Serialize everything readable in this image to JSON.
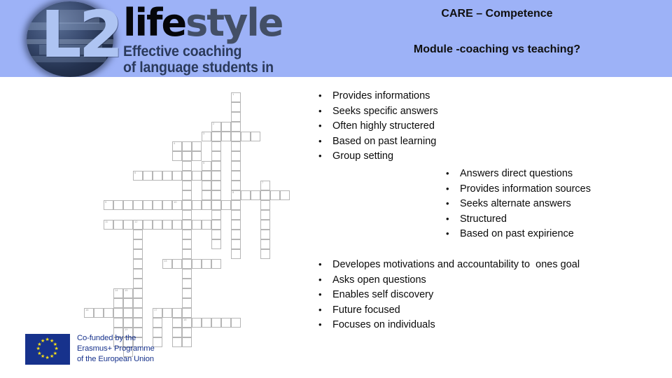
{
  "slide": {
    "background_color": "#ffffff",
    "header_band_color": "#9db2f7"
  },
  "header": {
    "title": "CARE – Competence",
    "subtitle": "Module -coaching vs teaching?",
    "brand": {
      "monogram": "L2",
      "wordmark_part1": "life",
      "wordmark_part2": "style",
      "wordmark_color1": "#05060a",
      "wordmark_color2": "#434f66",
      "tagline_line1": "Effective coaching",
      "tagline_line2": "of language students in Europe",
      "tagline_color": "#2b3a5c"
    }
  },
  "bullet_char": "•",
  "lists": {
    "teaching": {
      "name": "teaching-characteristics",
      "items": [
        "Provides informations",
        "Seeks specific answers",
        "Often highly structered",
        "Based on past learning",
        "Group setting"
      ]
    },
    "mentoring": {
      "name": "mentoring-characteristics",
      "items": [
        "Answers direct questions",
        "Provides information sources",
        "Seeks alternate answers",
        "Structured",
        "Based on past expirience"
      ]
    },
    "coaching": {
      "name": "coaching-characteristics",
      "items": [
        "Developes motivations and accountability to  ones goal",
        "Asks open questions",
        "Enables self discovery",
        "Future focused",
        "Focuses on individuals"
      ]
    }
  },
  "eu_logo": {
    "flag_color": "#17328c",
    "star_color": "#f7e017",
    "line1": "Co-funded by the",
    "line2": "Erasmus+ Programme",
    "line3": "of the European Union"
  },
  "crossword": {
    "note": "decorative faint crossword grid background",
    "cell_size": 14,
    "border_color": "#b6b6b6",
    "cells": [
      {
        "c": 13,
        "r": 0,
        "n": "1"
      },
      {
        "c": 13,
        "r": 1,
        "n": ""
      },
      {
        "c": 13,
        "r": 2,
        "n": ""
      },
      {
        "c": 13,
        "r": 3,
        "n": ""
      },
      {
        "c": 11,
        "r": 3,
        "n": "2"
      },
      {
        "c": 12,
        "r": 3,
        "n": ""
      },
      {
        "c": 10,
        "r": 4,
        "n": "3"
      },
      {
        "c": 11,
        "r": 4,
        "n": ""
      },
      {
        "c": 12,
        "r": 4,
        "n": ""
      },
      {
        "c": 13,
        "r": 4,
        "n": ""
      },
      {
        "c": 14,
        "r": 4,
        "n": ""
      },
      {
        "c": 15,
        "r": 4,
        "n": ""
      },
      {
        "c": 11,
        "r": 5,
        "n": ""
      },
      {
        "c": 13,
        "r": 5,
        "n": ""
      },
      {
        "c": 7,
        "r": 5,
        "n": "4"
      },
      {
        "c": 8,
        "r": 5,
        "n": ""
      },
      {
        "c": 9,
        "r": 5,
        "n": ""
      },
      {
        "c": 7,
        "r": 6,
        "n": ""
      },
      {
        "c": 8,
        "r": 6,
        "n": ""
      },
      {
        "c": 9,
        "r": 6,
        "n": ""
      },
      {
        "c": 11,
        "r": 6,
        "n": ""
      },
      {
        "c": 13,
        "r": 6,
        "n": ""
      },
      {
        "c": 8,
        "r": 7,
        "n": ""
      },
      {
        "c": 11,
        "r": 7,
        "n": ""
      },
      {
        "c": 13,
        "r": 7,
        "n": ""
      },
      {
        "c": 10,
        "r": 7,
        "n": "5"
      },
      {
        "c": 3,
        "r": 8,
        "n": "6"
      },
      {
        "c": 4,
        "r": 8,
        "n": ""
      },
      {
        "c": 5,
        "r": 8,
        "n": ""
      },
      {
        "c": 6,
        "r": 8,
        "n": ""
      },
      {
        "c": 7,
        "r": 8,
        "n": ""
      },
      {
        "c": 8,
        "r": 8,
        "n": ""
      },
      {
        "c": 9,
        "r": 8,
        "n": ""
      },
      {
        "c": 10,
        "r": 8,
        "n": ""
      },
      {
        "c": 11,
        "r": 8,
        "n": ""
      },
      {
        "c": 13,
        "r": 8,
        "n": ""
      },
      {
        "c": 8,
        "r": 9,
        "n": ""
      },
      {
        "c": 10,
        "r": 9,
        "n": ""
      },
      {
        "c": 11,
        "r": 9,
        "n": ""
      },
      {
        "c": 13,
        "r": 9,
        "n": ""
      },
      {
        "c": 16,
        "r": 9,
        "n": "7"
      },
      {
        "c": 8,
        "r": 10,
        "n": ""
      },
      {
        "c": 10,
        "r": 10,
        "n": ""
      },
      {
        "c": 11,
        "r": 10,
        "n": ""
      },
      {
        "c": 13,
        "r": 10,
        "n": "8"
      },
      {
        "c": 14,
        "r": 10,
        "n": ""
      },
      {
        "c": 15,
        "r": 10,
        "n": ""
      },
      {
        "c": 16,
        "r": 10,
        "n": ""
      },
      {
        "c": 17,
        "r": 10,
        "n": ""
      },
      {
        "c": 18,
        "r": 10,
        "n": ""
      },
      {
        "c": 0,
        "r": 11,
        "n": "9"
      },
      {
        "c": 1,
        "r": 11,
        "n": ""
      },
      {
        "c": 2,
        "r": 11,
        "n": ""
      },
      {
        "c": 3,
        "r": 11,
        "n": ""
      },
      {
        "c": 4,
        "r": 11,
        "n": ""
      },
      {
        "c": 5,
        "r": 11,
        "n": ""
      },
      {
        "c": 6,
        "r": 11,
        "n": ""
      },
      {
        "c": 7,
        "r": 11,
        "n": "10"
      },
      {
        "c": 8,
        "r": 11,
        "n": ""
      },
      {
        "c": 9,
        "r": 11,
        "n": ""
      },
      {
        "c": 10,
        "r": 11,
        "n": ""
      },
      {
        "c": 11,
        "r": 11,
        "n": ""
      },
      {
        "c": 12,
        "r": 11,
        "n": ""
      },
      {
        "c": 13,
        "r": 11,
        "n": ""
      },
      {
        "c": 16,
        "r": 11,
        "n": ""
      },
      {
        "c": 8,
        "r": 12,
        "n": ""
      },
      {
        "c": 11,
        "r": 12,
        "n": ""
      },
      {
        "c": 13,
        "r": 12,
        "n": ""
      },
      {
        "c": 16,
        "r": 12,
        "n": ""
      },
      {
        "c": 0,
        "r": 13,
        "n": "11"
      },
      {
        "c": 1,
        "r": 13,
        "n": ""
      },
      {
        "c": 2,
        "r": 13,
        "n": ""
      },
      {
        "c": 3,
        "r": 13,
        "n": "12"
      },
      {
        "c": 4,
        "r": 13,
        "n": ""
      },
      {
        "c": 5,
        "r": 13,
        "n": ""
      },
      {
        "c": 6,
        "r": 13,
        "n": ""
      },
      {
        "c": 7,
        "r": 13,
        "n": ""
      },
      {
        "c": 8,
        "r": 13,
        "n": ""
      },
      {
        "c": 9,
        "r": 13,
        "n": ""
      },
      {
        "c": 10,
        "r": 13,
        "n": ""
      },
      {
        "c": 11,
        "r": 13,
        "n": ""
      },
      {
        "c": 13,
        "r": 13,
        "n": ""
      },
      {
        "c": 16,
        "r": 13,
        "n": ""
      },
      {
        "c": 3,
        "r": 14,
        "n": ""
      },
      {
        "c": 8,
        "r": 14,
        "n": ""
      },
      {
        "c": 11,
        "r": 14,
        "n": ""
      },
      {
        "c": 13,
        "r": 14,
        "n": ""
      },
      {
        "c": 16,
        "r": 14,
        "n": ""
      },
      {
        "c": 3,
        "r": 15,
        "n": ""
      },
      {
        "c": 8,
        "r": 15,
        "n": ""
      },
      {
        "c": 11,
        "r": 15,
        "n": ""
      },
      {
        "c": 13,
        "r": 15,
        "n": ""
      },
      {
        "c": 16,
        "r": 15,
        "n": ""
      },
      {
        "c": 3,
        "r": 16,
        "n": ""
      },
      {
        "c": 8,
        "r": 16,
        "n": ""
      },
      {
        "c": 13,
        "r": 16,
        "n": ""
      },
      {
        "c": 16,
        "r": 16,
        "n": ""
      },
      {
        "c": 3,
        "r": 17,
        "n": ""
      },
      {
        "c": 6,
        "r": 17,
        "n": "13"
      },
      {
        "c": 7,
        "r": 17,
        "n": ""
      },
      {
        "c": 8,
        "r": 17,
        "n": ""
      },
      {
        "c": 9,
        "r": 17,
        "n": ""
      },
      {
        "c": 10,
        "r": 17,
        "n": ""
      },
      {
        "c": 11,
        "r": 17,
        "n": ""
      },
      {
        "c": 3,
        "r": 18,
        "n": ""
      },
      {
        "c": 8,
        "r": 18,
        "n": ""
      },
      {
        "c": 3,
        "r": 19,
        "n": ""
      },
      {
        "c": 8,
        "r": 19,
        "n": ""
      },
      {
        "c": 1,
        "r": 20,
        "n": "14"
      },
      {
        "c": 3,
        "r": 20,
        "n": ""
      },
      {
        "c": 2,
        "r": 20,
        "n": "15"
      },
      {
        "c": 8,
        "r": 20,
        "n": ""
      },
      {
        "c": 1,
        "r": 21,
        "n": ""
      },
      {
        "c": 2,
        "r": 21,
        "n": ""
      },
      {
        "c": 3,
        "r": 21,
        "n": ""
      },
      {
        "c": 8,
        "r": 21,
        "n": ""
      },
      {
        "c": -2,
        "r": 22,
        "n": "16"
      },
      {
        "c": -1,
        "r": 22,
        "n": ""
      },
      {
        "c": 0,
        "r": 22,
        "n": ""
      },
      {
        "c": 1,
        "r": 22,
        "n": ""
      },
      {
        "c": 2,
        "r": 22,
        "n": ""
      },
      {
        "c": 3,
        "r": 22,
        "n": ""
      },
      {
        "c": 5,
        "r": 22,
        "n": "17"
      },
      {
        "c": 6,
        "r": 22,
        "n": ""
      },
      {
        "c": 7,
        "r": 22,
        "n": ""
      },
      {
        "c": 8,
        "r": 22,
        "n": ""
      },
      {
        "c": 1,
        "r": 23,
        "n": ""
      },
      {
        "c": 2,
        "r": 23,
        "n": ""
      },
      {
        "c": 3,
        "r": 23,
        "n": ""
      },
      {
        "c": 5,
        "r": 23,
        "n": ""
      },
      {
        "c": 7,
        "r": 23,
        "n": ""
      },
      {
        "c": 8,
        "r": 23,
        "n": "18"
      },
      {
        "c": 9,
        "r": 23,
        "n": ""
      },
      {
        "c": 10,
        "r": 23,
        "n": ""
      },
      {
        "c": 11,
        "r": 23,
        "n": ""
      },
      {
        "c": 12,
        "r": 23,
        "n": ""
      },
      {
        "c": 13,
        "r": 23,
        "n": ""
      },
      {
        "c": 1,
        "r": 24,
        "n": ""
      },
      {
        "c": 2,
        "r": 24,
        "n": "19"
      },
      {
        "c": 3,
        "r": 24,
        "n": ""
      },
      {
        "c": 5,
        "r": 24,
        "n": ""
      },
      {
        "c": 7,
        "r": 24,
        "n": ""
      },
      {
        "c": 8,
        "r": 24,
        "n": ""
      },
      {
        "c": 1,
        "r": 25,
        "n": ""
      },
      {
        "c": 2,
        "r": 25,
        "n": ""
      },
      {
        "c": 3,
        "r": 25,
        "n": ""
      },
      {
        "c": 5,
        "r": 25,
        "n": ""
      },
      {
        "c": 7,
        "r": 25,
        "n": ""
      },
      {
        "c": 8,
        "r": 25,
        "n": ""
      },
      {
        "c": 2,
        "r": 26,
        "n": ""
      }
    ]
  }
}
